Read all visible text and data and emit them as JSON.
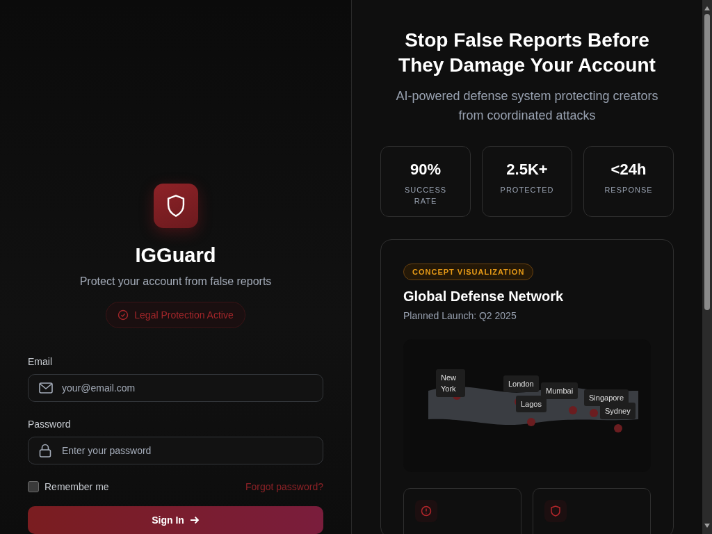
{
  "brand": {
    "name": "IGGuard",
    "tagline": "Protect your account from false reports",
    "status_badge": "Legal Protection Active"
  },
  "form": {
    "fields": [
      {
        "kind": "email",
        "label": "Email",
        "placeholder": "your@email.com"
      },
      {
        "kind": "password",
        "label": "Password",
        "placeholder": "Enter your password"
      }
    ],
    "remember": {
      "label": "Remember me",
      "checked": false
    },
    "forgot_link": "Forgot password?",
    "submit": "Sign In"
  },
  "hero": {
    "title": "Stop False Reports Before They Damage Your Account",
    "subtitle": "AI-powered defense system protecting creators from coordinated attacks"
  },
  "stats": [
    {
      "value": "90%",
      "label": "SUCCESS RATE"
    },
    {
      "value": "2.5K+",
      "label": "PROTECTED"
    },
    {
      "value": "<24h",
      "label": "RESPONSE"
    }
  ],
  "network": {
    "badge": "CONCEPT VISUALIZATION",
    "title": "Global Defense Network",
    "subtitle": "Planned Launch: Q2 2025",
    "cities": [
      "New York",
      "London",
      "Lagos",
      "Mumbai",
      "Singapore",
      "Sydney"
    ]
  },
  "features": [
    {
      "kind": "alert"
    },
    {
      "kind": "shield"
    }
  ]
}
